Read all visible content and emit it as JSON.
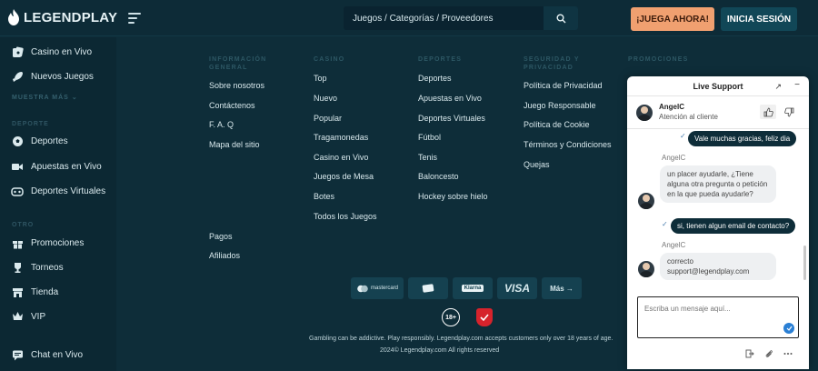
{
  "brand": {
    "name_part1": "LEGEND",
    "name_part2": "PLAY"
  },
  "header": {
    "search_placeholder": "Juegos / Categorías / Proveedores",
    "play_button": "¡JUEGA AHORA!",
    "login_button": "INICIA SESIÓN"
  },
  "sidebar": {
    "items_top": [
      {
        "label": "Casino en Vivo",
        "icon": "casino-chip-icon"
      },
      {
        "label": "Nuevos Juegos",
        "icon": "rocket-icon"
      }
    ],
    "show_more": "MUESTRA MÁS",
    "section_sports": "DEPORTE",
    "items_sports": [
      {
        "label": "Deportes",
        "icon": "soccer-ball-icon"
      },
      {
        "label": "Apuestas en Vivo",
        "icon": "video-camera-icon"
      },
      {
        "label": "Deportes Virtuales",
        "icon": "gamepad-icon"
      }
    ],
    "section_extra": "OTRO",
    "items_extra": [
      {
        "label": "Promociones",
        "icon": "gift-icon"
      },
      {
        "label": "Torneos",
        "icon": "trophy-icon"
      },
      {
        "label": "Tienda",
        "icon": "shop-icon"
      },
      {
        "label": "VIP",
        "icon": "crown-icon"
      }
    ],
    "chat_item": {
      "label": "Chat en Vivo",
      "icon": "chat-bubble-icon"
    }
  },
  "footer": {
    "columns": [
      {
        "heading": "INFORMACIÓN GENERAL",
        "links": [
          "Sobre nosotros",
          "Contáctenos",
          "F. A. Q",
          "Mapa del sitio"
        ]
      },
      {
        "heading": "CASINO",
        "links": [
          "Top",
          "Nuevo",
          "Popular",
          "Tragamonedas",
          "Casino en Vivo",
          "Juegos de Mesa",
          "Botes",
          "Todos los Juegos"
        ]
      },
      {
        "heading": "DEPORTES",
        "links": [
          "Deportes",
          "Apuestas en Vivo",
          "Deportes Virtuales",
          "Fútbol",
          "Tenis",
          "Baloncesto",
          "Hockey sobre hielo"
        ]
      },
      {
        "heading": "SEGURIDAD Y PRIVACIDAD",
        "links": [
          "Política de Privacidad",
          "Juego Responsable",
          "Política de Cookie",
          "Términos y Condiciones",
          "Quejas"
        ]
      },
      {
        "heading": "PROMOCIONES",
        "links": []
      }
    ],
    "extra_links": [
      "Pagos",
      "Afiliados"
    ],
    "payments": [
      "mastercard",
      "paysafecard",
      "Klarna",
      "VISA",
      "Más →"
    ],
    "age_badge": "18+",
    "disclaimer": "Gambling can be addictive. Play responsibly. Legendplay.com accepts customers only over 18 years of age.",
    "copyright": "2024© Legendplay.com All rights reserved"
  },
  "chat": {
    "title": "Live Support",
    "agent_name": "AngelC",
    "agent_role": "Atención al cliente",
    "messages": [
      {
        "from": "user",
        "text": "Vale muchas gracias, feliz dia"
      },
      {
        "from": "agent",
        "sender": "AngelC",
        "text": "un placer ayudarle, ¿Tiene alguna otra pregunta o petición en la que pueda ayudarle?"
      },
      {
        "from": "user",
        "text": "si, tienen algun email de contacto?"
      },
      {
        "from": "agent",
        "sender": "AngelC",
        "text": "correcto support@legendplay.com"
      }
    ],
    "input_placeholder": "Escriba un mensaje aquí..."
  },
  "colors": {
    "background": "#0e2d39",
    "accent_orange": "#f0a070",
    "login_bg": "#114757",
    "chat_bubble_user": "#0e2d39"
  }
}
